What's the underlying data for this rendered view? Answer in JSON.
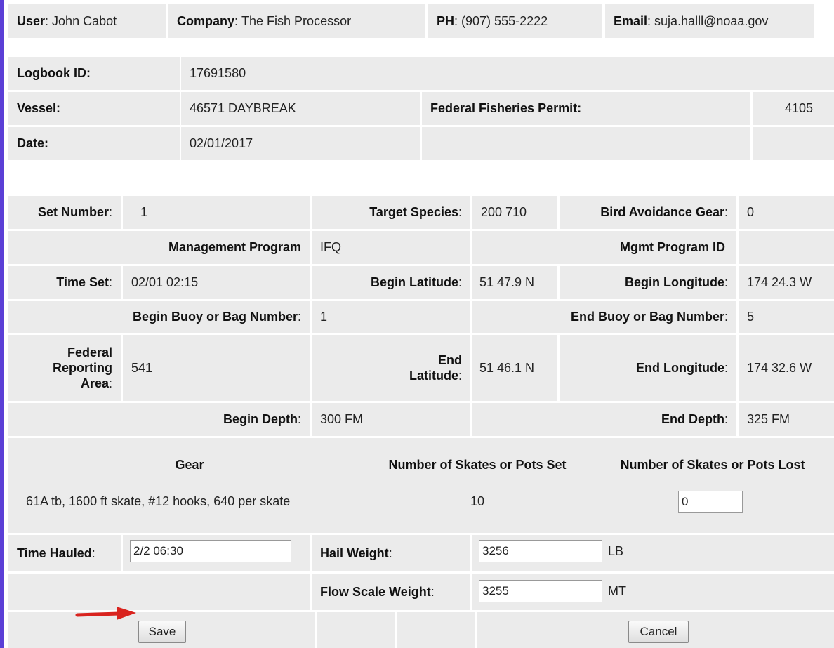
{
  "header": {
    "user_label": "User",
    "user_value": "John Cabot",
    "company_label": "Company",
    "company_value": "The Fish Processor",
    "phone_label": "PH",
    "phone_value": "(907) 555-2222",
    "email_label": "Email",
    "email_value": "suja.halll@noaa.gov"
  },
  "logbook": {
    "id_label": "Logbook ID:",
    "id_value": "17691580",
    "vessel_label": "Vessel:",
    "vessel_value": "46571 DAYBREAK",
    "permit_label": "Federal Fisheries Permit:",
    "permit_value": "4105",
    "date_label": "Date:",
    "date_value": "02/01/2017"
  },
  "set": {
    "set_number_label": "Set Number",
    "set_number_value": "1",
    "target_species_label": "Target Species",
    "target_species_value": "200 710",
    "bird_gear_label": "Bird Avoidance Gear",
    "bird_gear_value": "0",
    "mgmt_program_label": "Management Program",
    "mgmt_program_value": "IFQ",
    "mgmt_program_id_label": "Mgmt Program ID",
    "mgmt_program_id_value": "",
    "time_set_label": "Time Set",
    "time_set_value": "02/01 02:15",
    "begin_lat_label": "Begin Latitude",
    "begin_lat_value": "51 47.9 N",
    "begin_lon_label": "Begin Longitude",
    "begin_lon_value": "174 24.3 W",
    "begin_buoy_label": "Begin Buoy or Bag Number",
    "begin_buoy_value": "1",
    "end_buoy_label": "End Buoy or Bag Number",
    "end_buoy_value": "5",
    "fed_area_label_1": "Federal",
    "fed_area_label_2": "Reporting",
    "fed_area_label_3": "Area",
    "fed_area_value": "541",
    "end_lat_label_1": "End",
    "end_lat_label_2": "Latitude",
    "end_lat_value": "51 46.1 N",
    "end_lon_label": "End Longitude",
    "end_lon_value": "174 32.6 W",
    "begin_depth_label": "Begin Depth",
    "begin_depth_value": "300 FM",
    "end_depth_label": "End Depth",
    "end_depth_value": "325 FM"
  },
  "gear": {
    "gear_header": "Gear",
    "pots_set_header": "Number of Skates or Pots Set",
    "pots_lost_header": "Number of Skates or Pots Lost",
    "gear_value": "61A tb, 1600 ft skate, #12 hooks, 640 per skate",
    "pots_set_value": "10",
    "pots_lost_input": "0"
  },
  "haul": {
    "time_hauled_label": "Time Hauled",
    "time_hauled_input": "2/2 06:30",
    "hail_weight_label": "Hail Weight",
    "hail_weight_input": "3256",
    "hail_weight_unit": "LB",
    "flow_scale_label": "Flow Scale Weight",
    "flow_scale_input": "3255",
    "flow_scale_unit": "MT"
  },
  "actions": {
    "save_label": "Save",
    "cancel_label": "Cancel"
  },
  "colors": {
    "left_bar": "#5b3fd6",
    "cell_bg": "#ebebeb",
    "arrow": "#d9241f"
  },
  "icons": {
    "pointer": "red-arrow-icon"
  }
}
